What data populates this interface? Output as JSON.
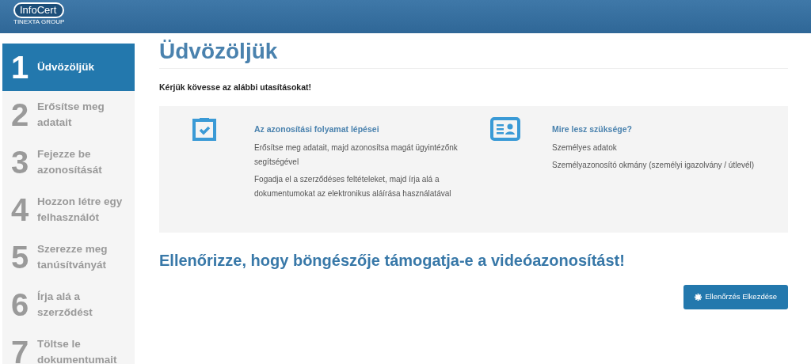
{
  "header": {
    "logo": {
      "name": "InfoCert",
      "group": "TINEXTA GROUP"
    }
  },
  "steps": [
    {
      "number": "1",
      "label": "Üdvözöljük",
      "selected": true
    },
    {
      "number": "2",
      "label": "Erősítse meg adatait",
      "selected": false
    },
    {
      "number": "3",
      "label": "Fejezze be azonosítását",
      "selected": false
    },
    {
      "number": "4",
      "label": "Hozzon létre egy felhasználót",
      "selected": false
    },
    {
      "number": "5",
      "label": "Szerezze meg tanúsítványát",
      "selected": false
    },
    {
      "number": "6",
      "label": "Írja alá a szerződést",
      "selected": false
    },
    {
      "number": "7",
      "label": "Töltse le dokumentumait",
      "selected": false
    }
  ],
  "page_title": "Üdvözöljük",
  "intro": "Kérjük kövesse az alábbi utasításokat!",
  "info_panel": [
    {
      "kind": "clipboard",
      "title": "Az azonosítási folyamat lépései",
      "lines": [
        "Erősítse meg adatait, majd azonosítsa magát ügyintézőnk segítségével",
        "Fogadja el a szerződéses feltételeket, majd írja alá a dokumentumokat az elektronikus aláírása használatával"
      ]
    },
    {
      "kind": "id-card",
      "title": "Mire lesz szüksége?",
      "lines": [
        "Személyes adatok",
        "Személyazonosító okmány (személyi igazolvány / útlevél)"
      ]
    }
  ],
  "browser_check": {
    "heading": "Ellenőrizze, hogy böngészője támogatja-e a videóazonosítást!",
    "button": "Ellenőrzés Elkezdése"
  }
}
